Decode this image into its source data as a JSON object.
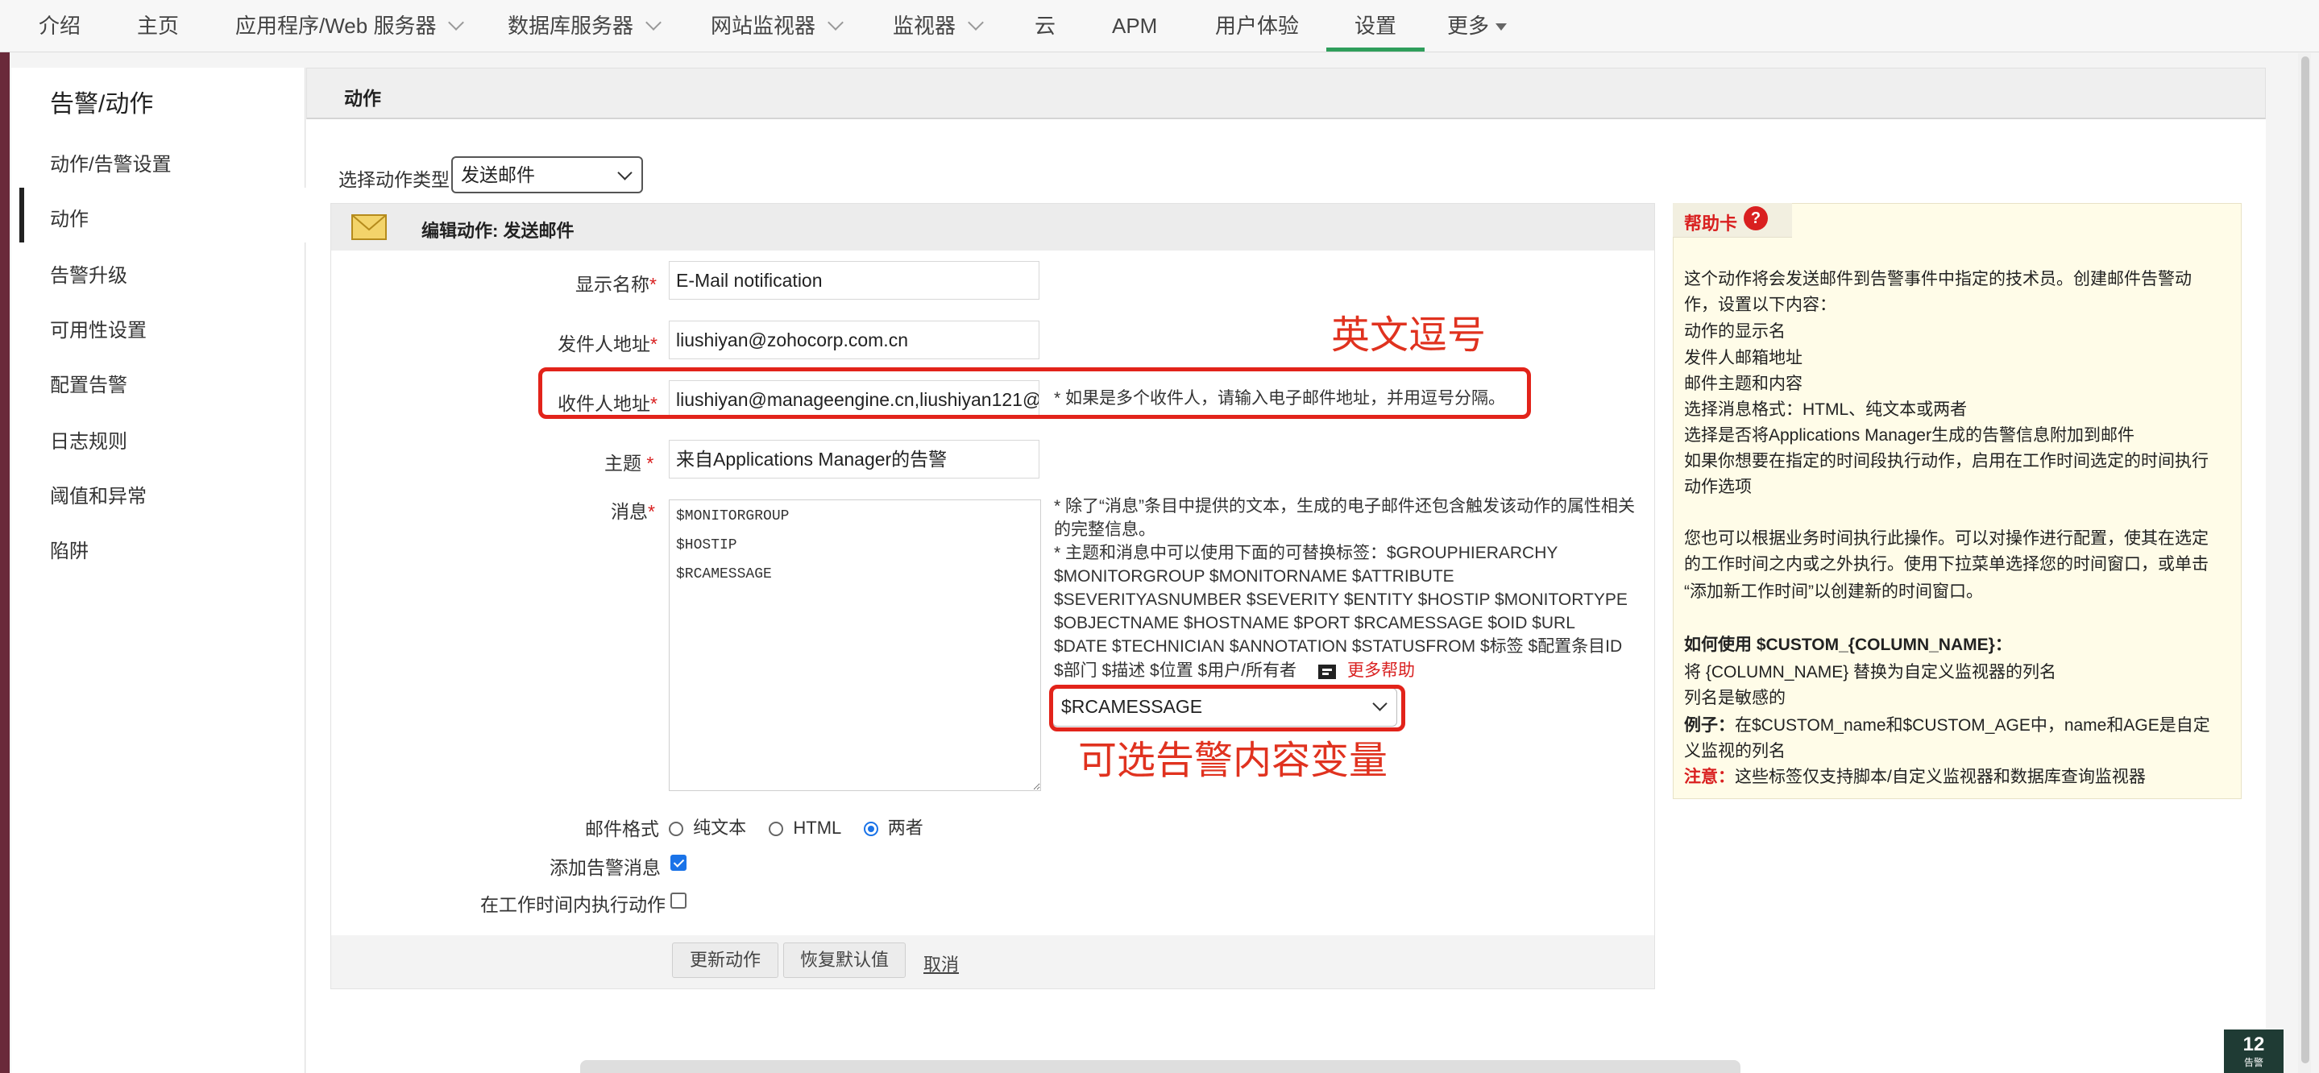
{
  "nav": {
    "items": [
      "介绍",
      "主页",
      "应用程序/Web 服务器",
      "数据库服务器",
      "网站监视器",
      "监视器",
      "云",
      "APM",
      "用户体验",
      "设置",
      "更多"
    ],
    "active": "设置"
  },
  "sidebar": {
    "title": "告警/动作",
    "items": [
      "动作/告警设置",
      "动作",
      "告警升级",
      "可用性设置",
      "配置告警",
      "日志规则",
      "阈值和异常",
      "陷阱"
    ],
    "active": "动作"
  },
  "panel": {
    "title": "动作"
  },
  "action_type": {
    "label": "选择动作类型",
    "value": "发送邮件"
  },
  "edit": {
    "header": "编辑动作: 发送邮件",
    "display_name": {
      "label": "显示名称",
      "value": "E-Mail notification"
    },
    "from": {
      "label": "发件人地址",
      "value": "liushiyan@zohocorp.com.cn"
    },
    "to": {
      "label": "收件人地址",
      "value": "liushiyan@manageengine.cn,liushiyan121@",
      "hint": "* 如果是多个收件人，请输入电子邮件地址，并用逗号分隔。"
    },
    "subject": {
      "label": "主题",
      "value": "来自Applications Manager的告警"
    },
    "message": {
      "label": "消息",
      "value": "$MONITORGROUP\n$HOSTIP\n$RCAMESSAGE",
      "hint1": "* 除了“消息”条目中提供的文本，生成的电子邮件还包含触发该动作的属性相关的完整信息。",
      "hint2_lines": [
        "* 主题和消息中可以使用下面的可替换标签：$GROUPHIERARCHY",
        "$MONITORGROUP $MONITORNAME $ATTRIBUTE",
        "$SEVERITYASNUMBER $SEVERITY $ENTITY $HOSTIP $MONITORTYPE",
        "$OBJECTNAME $HOSTNAME $PORT $RCAMESSAGE $OID $URL",
        "$DATE $TECHNICIAN $ANNOTATION $STATUSFROM $标签 $配置条目ID",
        "$部门 $描述 $位置 $用户/所有者"
      ],
      "more_help": "更多帮助",
      "var_select": "$RCAMESSAGE"
    },
    "format": {
      "label": "邮件格式",
      "options": [
        "纯文本",
        "HTML",
        "两者"
      ],
      "selected": "两者"
    },
    "append_alarm": {
      "label": "添加告警消息",
      "checked": true
    },
    "business_hours": {
      "label": "在工作时间内执行动作",
      "checked": false
    },
    "buttons": {
      "update": "更新动作",
      "restore": "恢复默认值",
      "cancel": "取消"
    }
  },
  "annotations": {
    "comma": "英文逗号",
    "variable": "可选告警内容变量"
  },
  "help": {
    "title": "帮助卡",
    "lines": [
      "这个动作将会发送邮件到告警事件中指定的技术员。创建邮件告警动",
      "作，设置以下内容：",
      "动作的显示名",
      "发件人邮箱地址",
      "邮件主题和内容",
      "选择消息格式：HTML、纯文本或两者",
      "选择是否将Applications Manager生成的告警信息附加到邮件",
      "如果你想要在指定的时间段执行动作，启用在工作时间选定的时间执行",
      "动作选项",
      "",
      "您也可以根据业务时间执行此操作。可以对操作进行配置，使其在选定",
      "的工作时间之内或之外执行。使用下拉菜单选择您的时间窗口，或单击",
      "“添加新工作时间”以创建新的时间窗口。",
      "",
      "如何使用 $CUSTOM_{COLUMN_NAME}：",
      "将 {COLUMN_NAME} 替换为自定义监视器的列名",
      "列名是敏感的",
      "例子：在$CUSTOM_name和$CUSTOM_AGE中，name和AGE是自定",
      "义监视的列名",
      "注意：这些标签仅支持脚本/自定义监视器和数据库查询监视器"
    ]
  },
  "alarm_badge": {
    "count": "12",
    "label": "告警"
  }
}
